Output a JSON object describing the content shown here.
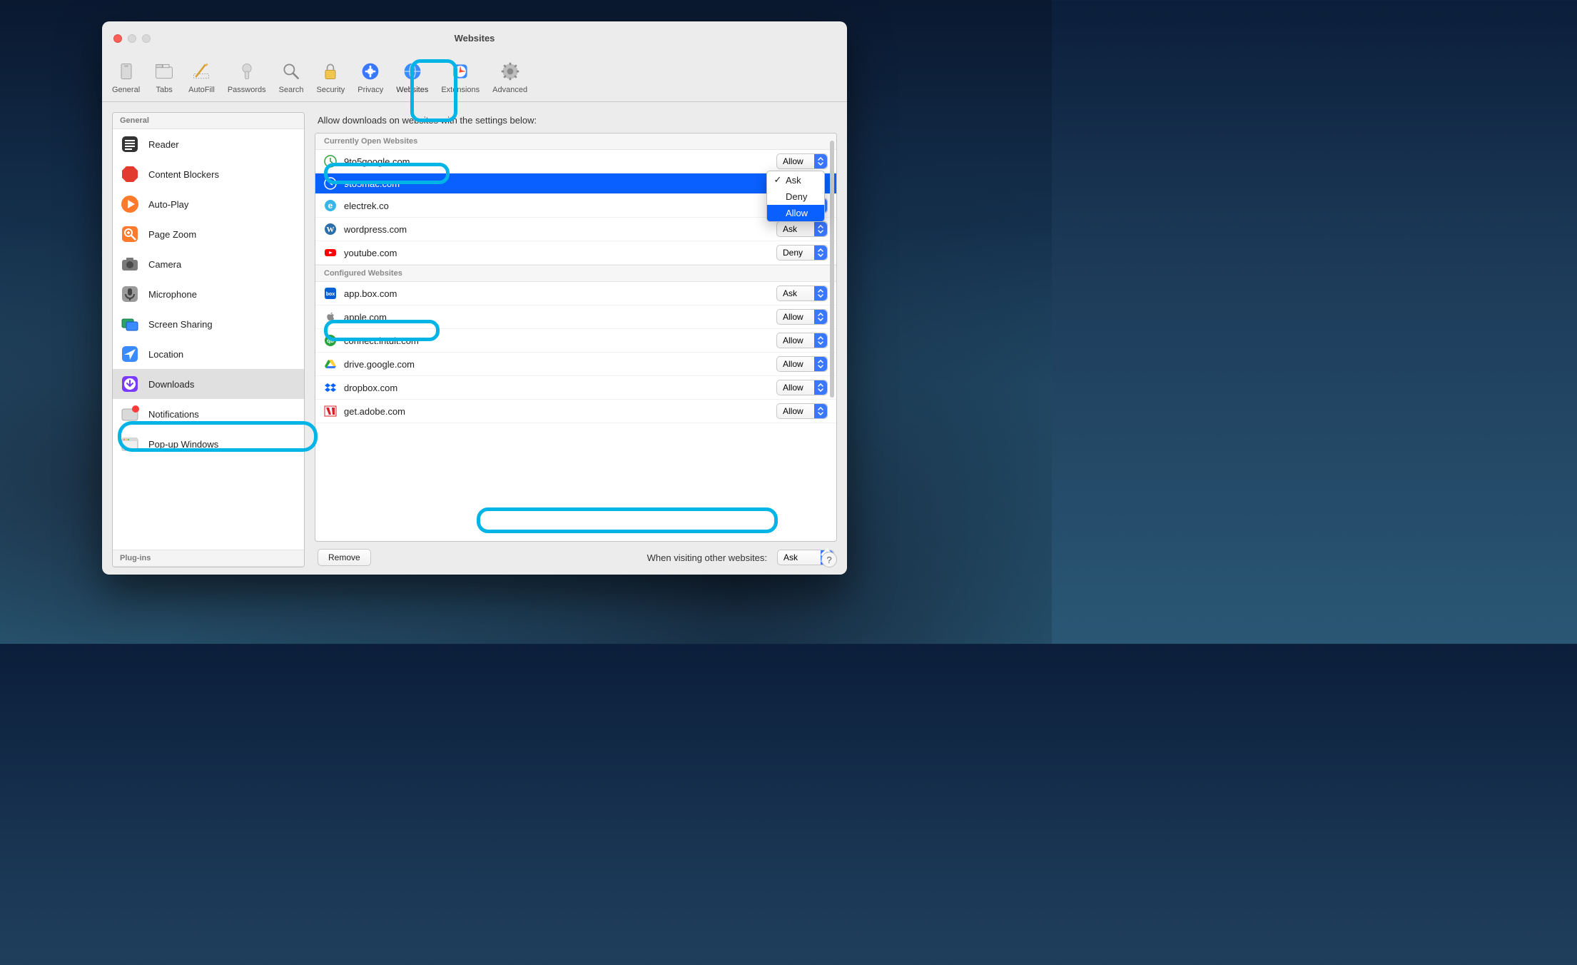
{
  "window": {
    "title": "Websites"
  },
  "toolbar": {
    "items": [
      {
        "key": "general",
        "label": "General"
      },
      {
        "key": "tabs",
        "label": "Tabs"
      },
      {
        "key": "autofill",
        "label": "AutoFill"
      },
      {
        "key": "passwords",
        "label": "Passwords"
      },
      {
        "key": "search",
        "label": "Search"
      },
      {
        "key": "security",
        "label": "Security"
      },
      {
        "key": "privacy",
        "label": "Privacy"
      },
      {
        "key": "websites",
        "label": "Websites",
        "active": true
      },
      {
        "key": "extensions",
        "label": "Extensions"
      },
      {
        "key": "advanced",
        "label": "Advanced"
      }
    ]
  },
  "sidebar": {
    "sections": [
      {
        "title": "General",
        "items": [
          {
            "key": "reader",
            "label": "Reader"
          },
          {
            "key": "content-blockers",
            "label": "Content Blockers"
          },
          {
            "key": "auto-play",
            "label": "Auto-Play"
          },
          {
            "key": "page-zoom",
            "label": "Page Zoom"
          },
          {
            "key": "camera",
            "label": "Camera"
          },
          {
            "key": "microphone",
            "label": "Microphone"
          },
          {
            "key": "screen-sharing",
            "label": "Screen Sharing"
          },
          {
            "key": "location",
            "label": "Location"
          },
          {
            "key": "downloads",
            "label": "Downloads",
            "selected": true
          },
          {
            "key": "notifications",
            "label": "Notifications"
          },
          {
            "key": "popup",
            "label": "Pop-up Windows"
          }
        ]
      },
      {
        "title": "Plug-ins",
        "items": []
      }
    ]
  },
  "main": {
    "heading": "Allow downloads on websites with the settings below:",
    "groups": [
      {
        "title": "Currently Open Websites",
        "rows": [
          {
            "favicon": "clock-green",
            "domain": "9to5google.com",
            "permission": "Allow"
          },
          {
            "favicon": "clock-white",
            "domain": "9to5mac.com",
            "permission": "Allow",
            "selected": true,
            "dropdown_open": true
          },
          {
            "favicon": "e-blue",
            "domain": "electrek.co",
            "permission": "Allow"
          },
          {
            "favicon": "wordpress",
            "domain": "wordpress.com",
            "permission": "Ask"
          },
          {
            "favicon": "youtube",
            "domain": "youtube.com",
            "permission": "Deny"
          }
        ]
      },
      {
        "title": "Configured Websites",
        "rows": [
          {
            "favicon": "box",
            "domain": "app.box.com",
            "permission": "Ask"
          },
          {
            "favicon": "apple",
            "domain": "apple.com",
            "permission": "Allow"
          },
          {
            "favicon": "qb",
            "domain": "connect.intuit.com",
            "permission": "Allow"
          },
          {
            "favicon": "gdrive",
            "domain": "drive.google.com",
            "permission": "Allow"
          },
          {
            "favicon": "dropbox",
            "domain": "dropbox.com",
            "permission": "Allow"
          },
          {
            "favicon": "adobe",
            "domain": "get.adobe.com",
            "permission": "Allow"
          }
        ]
      }
    ],
    "dropdown_options": [
      {
        "label": "Ask",
        "checked": true
      },
      {
        "label": "Deny"
      },
      {
        "label": "Allow",
        "hover": true
      }
    ],
    "remove_label": "Remove",
    "default_label": "When visiting other websites:",
    "default_value": "Ask"
  },
  "help_label": "?"
}
